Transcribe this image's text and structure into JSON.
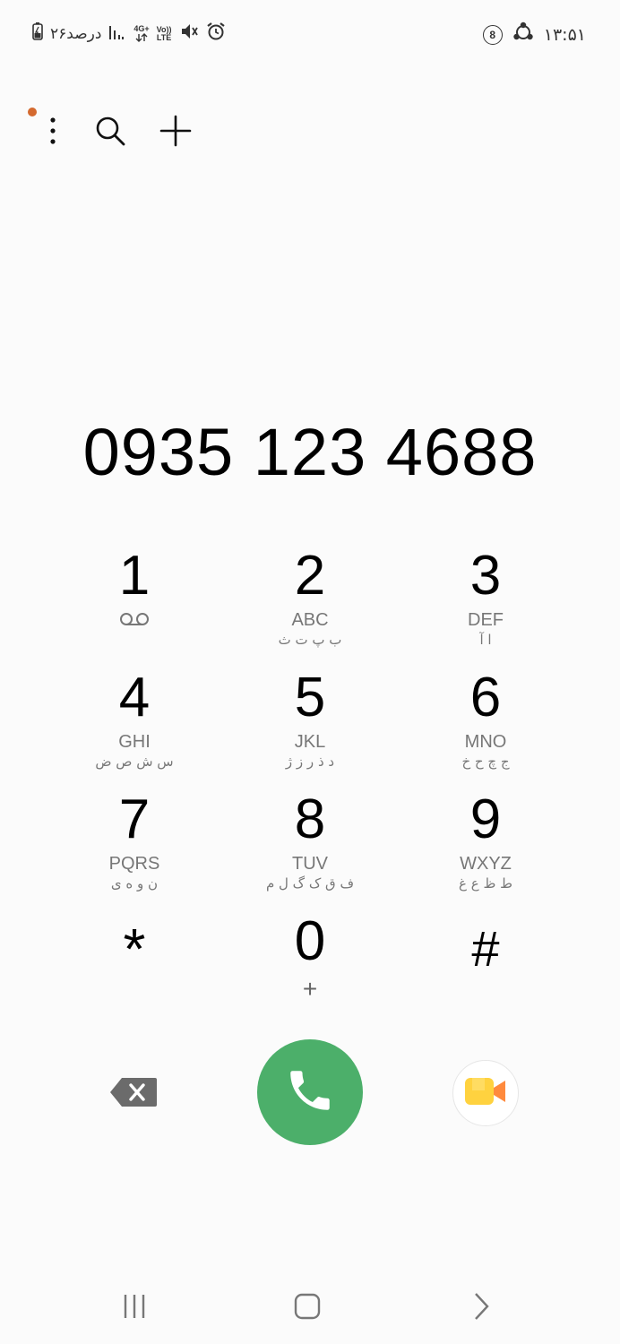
{
  "status_bar": {
    "battery_percent_text": "۲۶درصد",
    "network_label": "4G+",
    "volte_label_top": "Vo))",
    "volte_label_bottom": "LTE",
    "time": "۱۳:۵۱",
    "icons": [
      "battery-icon",
      "signal-icon",
      "network-4g-icon",
      "volte-icon",
      "mute-icon",
      "alarm-icon",
      "notification-count-icon",
      "sync-icon"
    ],
    "notification_count": "8"
  },
  "toolbar": {
    "icons": [
      "more-options-icon",
      "search-icon",
      "add-icon"
    ],
    "notif_dot_color": "#d46a2f"
  },
  "dialer": {
    "number": "0935 123 4688"
  },
  "keypad": {
    "keys": [
      {
        "digit": "1",
        "letters": "",
        "persian": "",
        "sub_icon": "voicemail-icon"
      },
      {
        "digit": "2",
        "letters": "ABC",
        "persian": "ب پ ت ث"
      },
      {
        "digit": "3",
        "letters": "DEF",
        "persian": "ا آ"
      },
      {
        "digit": "4",
        "letters": "GHI",
        "persian": "س ش ص ض"
      },
      {
        "digit": "5",
        "letters": "JKL",
        "persian": "د ذ ر ز ژ"
      },
      {
        "digit": "6",
        "letters": "MNO",
        "persian": "ج چ ح خ"
      },
      {
        "digit": "7",
        "letters": "PQRS",
        "persian": "ن و ه ی"
      },
      {
        "digit": "8",
        "letters": "TUV",
        "persian": "ف ق ک گ ل م"
      },
      {
        "digit": "9",
        "letters": "WXYZ",
        "persian": "ط ظ ع غ"
      },
      {
        "digit": "*",
        "letters": "",
        "persian": ""
      },
      {
        "digit": "0",
        "letters": "",
        "persian": "",
        "sub": "+"
      },
      {
        "digit": "#",
        "letters": "",
        "persian": ""
      }
    ]
  },
  "actions": {
    "call_color": "#4caf6a",
    "icons": [
      "backspace-icon",
      "phone-icon",
      "video-call-icon"
    ]
  },
  "navbar": {
    "icons": [
      "recents-icon",
      "home-icon",
      "back-icon"
    ]
  }
}
